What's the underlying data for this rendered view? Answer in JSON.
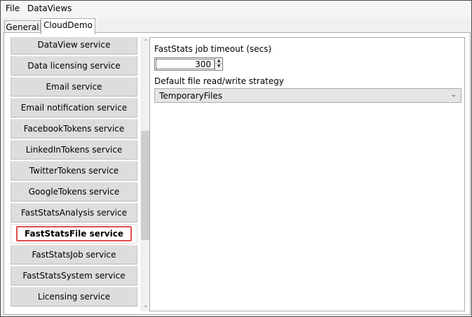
{
  "menu": {
    "file": "File",
    "dataviews": "DataViews"
  },
  "tabs": [
    {
      "label": "General",
      "active": false
    },
    {
      "label": "CloudDemo",
      "active": true
    }
  ],
  "services": [
    {
      "label": "DataView service",
      "selected": false
    },
    {
      "label": "Data licensing service",
      "selected": false
    },
    {
      "label": "Email service",
      "selected": false
    },
    {
      "label": "Email notification service",
      "selected": false
    },
    {
      "label": "FacebookTokens service",
      "selected": false
    },
    {
      "label": "LinkedInTokens service",
      "selected": false
    },
    {
      "label": "TwitterTokens service",
      "selected": false
    },
    {
      "label": "GoogleTokens service",
      "selected": false
    },
    {
      "label": "FastStatsAnalysis service",
      "selected": false
    },
    {
      "label": "FastStatsFile service",
      "selected": true
    },
    {
      "label": "FastStatsJob service",
      "selected": false
    },
    {
      "label": "FastStatsSystem service",
      "selected": false
    },
    {
      "label": "Licensing service",
      "selected": false
    }
  ],
  "settings": {
    "timeout_label": "FastStats job timeout (secs)",
    "timeout_value": "300",
    "strategy_label": "Default file read/write strategy",
    "strategy_value": "TemporaryFiles"
  },
  "icons": {
    "scroll_up": "chevron-up-icon",
    "scroll_down": "chevron-down-icon",
    "combo_arrow": "chevron-down-icon"
  },
  "colors": {
    "highlight_border": "#e04c4c",
    "selected_bg": "#ffffff",
    "item_bg": "#dddddd"
  }
}
